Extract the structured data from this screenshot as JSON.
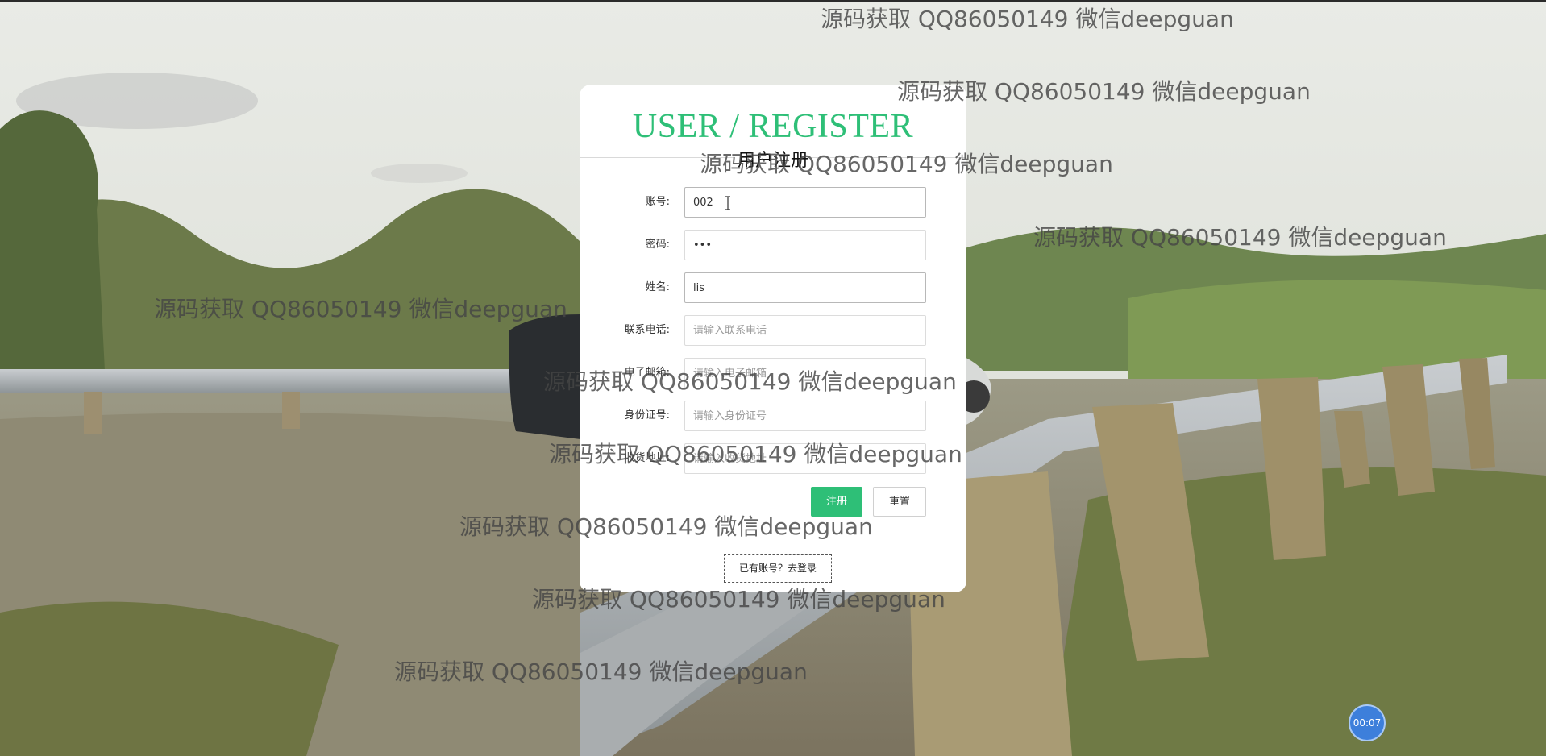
{
  "form": {
    "title": "USER / REGISTER",
    "subtitle": "用户注册",
    "fields": [
      {
        "label": "账号:",
        "value": "002",
        "placeholder": ""
      },
      {
        "label": "密码:",
        "value": "•••",
        "placeholder": ""
      },
      {
        "label": "姓名:",
        "value": "lis",
        "placeholder": ""
      },
      {
        "label": "联系电话:",
        "value": "",
        "placeholder": "请输入联系电话"
      },
      {
        "label": "电子邮箱:",
        "value": "",
        "placeholder": "请输入电子邮箱"
      },
      {
        "label": "身份证号:",
        "value": "",
        "placeholder": "请输入身份证号"
      },
      {
        "label": "收货地址:",
        "value": "",
        "placeholder": "请输入收货地址"
      }
    ],
    "register_label": "注册",
    "reset_label": "重置",
    "login_link": "已有账号？去登录"
  },
  "watermark_text": "源码获取 QQ86050149 微信deepguan",
  "timer": "00:07",
  "colors": {
    "accent": "#2ebf77",
    "timer": "#3d7fdb"
  }
}
